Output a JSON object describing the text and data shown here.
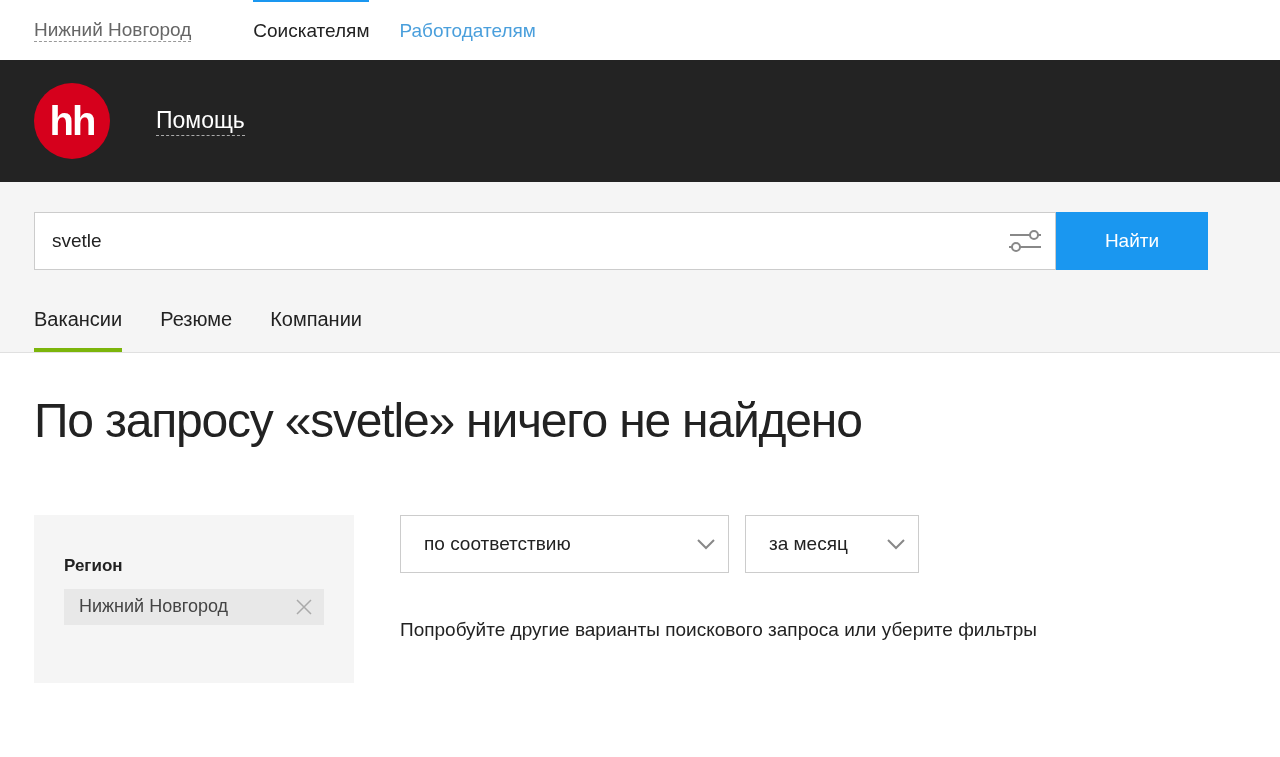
{
  "top_nav": {
    "city": "Нижний Новгород",
    "tabs": [
      {
        "label": "Соискателям",
        "selected": true
      },
      {
        "label": "Работодателям",
        "selected": false
      }
    ]
  },
  "header": {
    "logo": "hh",
    "links": [
      "Помощь"
    ]
  },
  "search": {
    "value": "svetle",
    "button": "Найти"
  },
  "search_tabs": [
    {
      "label": "Вакансии",
      "selected": true
    },
    {
      "label": "Резюме",
      "selected": false
    },
    {
      "label": "Компании",
      "selected": false
    }
  ],
  "heading": "По запросу «svetle» ничего не найдено",
  "filter": {
    "title": "Регион",
    "chips": [
      "Нижний Новгород"
    ]
  },
  "dropdowns": [
    "по соответствию",
    "за месяц"
  ],
  "message": "Попробуйте другие варианты поискового запроса или уберите фильтры"
}
